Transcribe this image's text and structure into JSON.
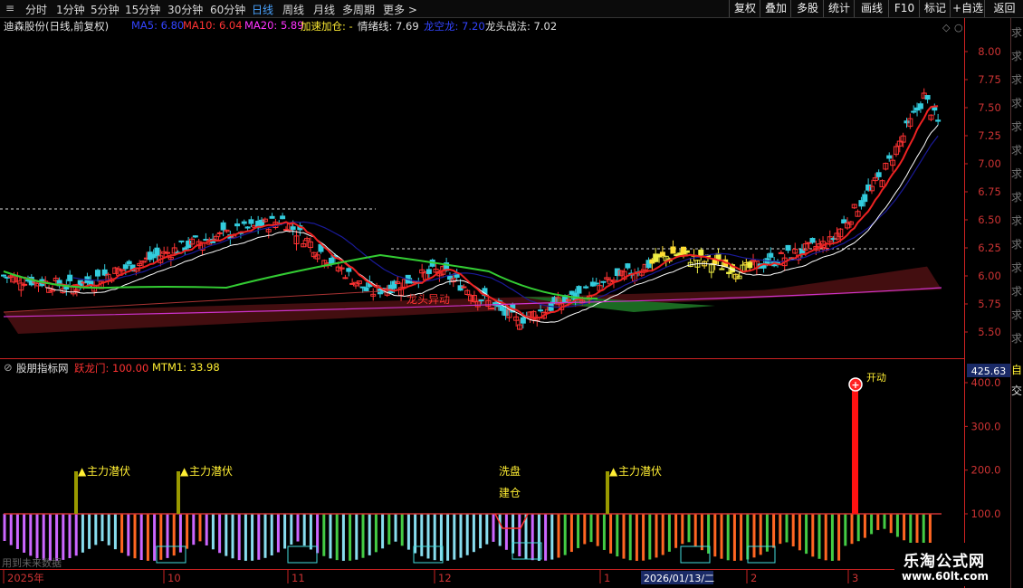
{
  "topbar": {
    "tabs": [
      "分时",
      "1分钟",
      "5分钟",
      "15分钟",
      "30分钟",
      "60分钟",
      "日线",
      "周线",
      "月线",
      "多周期",
      "更多 >"
    ],
    "active_tab": "日线",
    "right_buttons": [
      "复权",
      "叠加",
      "多股",
      "统计",
      "画线",
      "F10",
      "标记",
      "+自选",
      "返回"
    ]
  },
  "main_legend": {
    "stock": "迪森股份(日线,前复权)",
    "ma5": "MA5: 6.80",
    "ma10": "MA10: 6.04",
    "ma20": "MA20: 5.89",
    "accel": "加速加仓: -",
    "mood": "情绪线: 7.69",
    "dragon_empty": "龙空龙: 7.20",
    "dragon_head": "龙头战法: 7.02"
  },
  "sub_legend": {
    "title": "股朋指标网",
    "ylm": "跃龙门: 100.00",
    "mtm": "MTM1: 33.98"
  },
  "annotations": {
    "main_force_1": "主力潜伏",
    "main_force_2": "主力潜伏",
    "main_force_3": "主力潜伏",
    "wash": "洗盘",
    "build": "建仓",
    "dragon_move": "龙头异动",
    "launch": "开动"
  },
  "price_axis": [
    "8.00",
    "7.75",
    "7.50",
    "7.25",
    "7.00",
    "6.75",
    "6.50",
    "6.25",
    "6.00",
    "5.75",
    "5.50"
  ],
  "sub_axis": [
    "400.0",
    "300.0",
    "200.0",
    "100.0"
  ],
  "sub_top_value": "425.63",
  "date_axis": [
    "2025年",
    "10",
    "11",
    "12",
    "1",
    "2026/01/13/二",
    "2",
    "3"
  ],
  "future_data_note": "用到未来数据",
  "watermark": {
    "line1": "乐淘公式网",
    "line2": "www.60lt.com"
  },
  "right_edge_text": [
    "自",
    "交"
  ],
  "colors": {
    "up": "#ff3333",
    "down": "#33ccdd",
    "ma5": "#ffffff",
    "ma10": "#ff2222",
    "ma20": "#2222cc",
    "accent": "#4aa3ff",
    "axis": "#cc2222"
  }
}
